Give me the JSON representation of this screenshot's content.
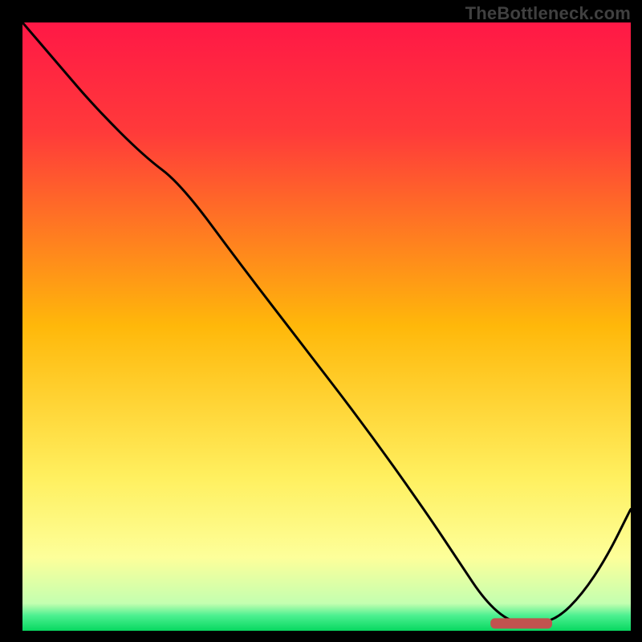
{
  "watermark": "TheBottleneck.com",
  "colors": {
    "frame": "#000000",
    "gradient_top": "#ff1846",
    "gradient_mid": "#ffc20a",
    "gradient_low": "#ffff6e",
    "gradient_bottom_yellow": "#f6ff8e",
    "gradient_green": "#08e070",
    "curve": "#000000",
    "marker_fill": "#c1534f",
    "marker_stroke": "#c1534f"
  },
  "chart_data": {
    "type": "line",
    "title": "",
    "xlabel": "",
    "ylabel": "",
    "xlim": [
      0,
      100
    ],
    "ylim": [
      0,
      100
    ],
    "x": [
      0,
      6,
      12,
      20,
      26,
      36,
      46,
      56,
      66,
      72,
      76,
      80,
      84,
      88,
      92,
      96,
      100
    ],
    "values": [
      100,
      93,
      86,
      78,
      73.5,
      60,
      47,
      34,
      20,
      11,
      5,
      1.5,
      1,
      2,
      6,
      12,
      20
    ],
    "marker": {
      "x_center": 82,
      "width": 10,
      "y": 1.2
    },
    "gradient_stops": [
      {
        "pos": 0.0,
        "color": "#ff1846"
      },
      {
        "pos": 0.18,
        "color": "#ff3a3a"
      },
      {
        "pos": 0.5,
        "color": "#ffb80a"
      },
      {
        "pos": 0.75,
        "color": "#fff060"
      },
      {
        "pos": 0.88,
        "color": "#fdff9a"
      },
      {
        "pos": 0.955,
        "color": "#c4ffb0"
      },
      {
        "pos": 0.975,
        "color": "#4cf090"
      },
      {
        "pos": 1.0,
        "color": "#08d860"
      }
    ]
  }
}
